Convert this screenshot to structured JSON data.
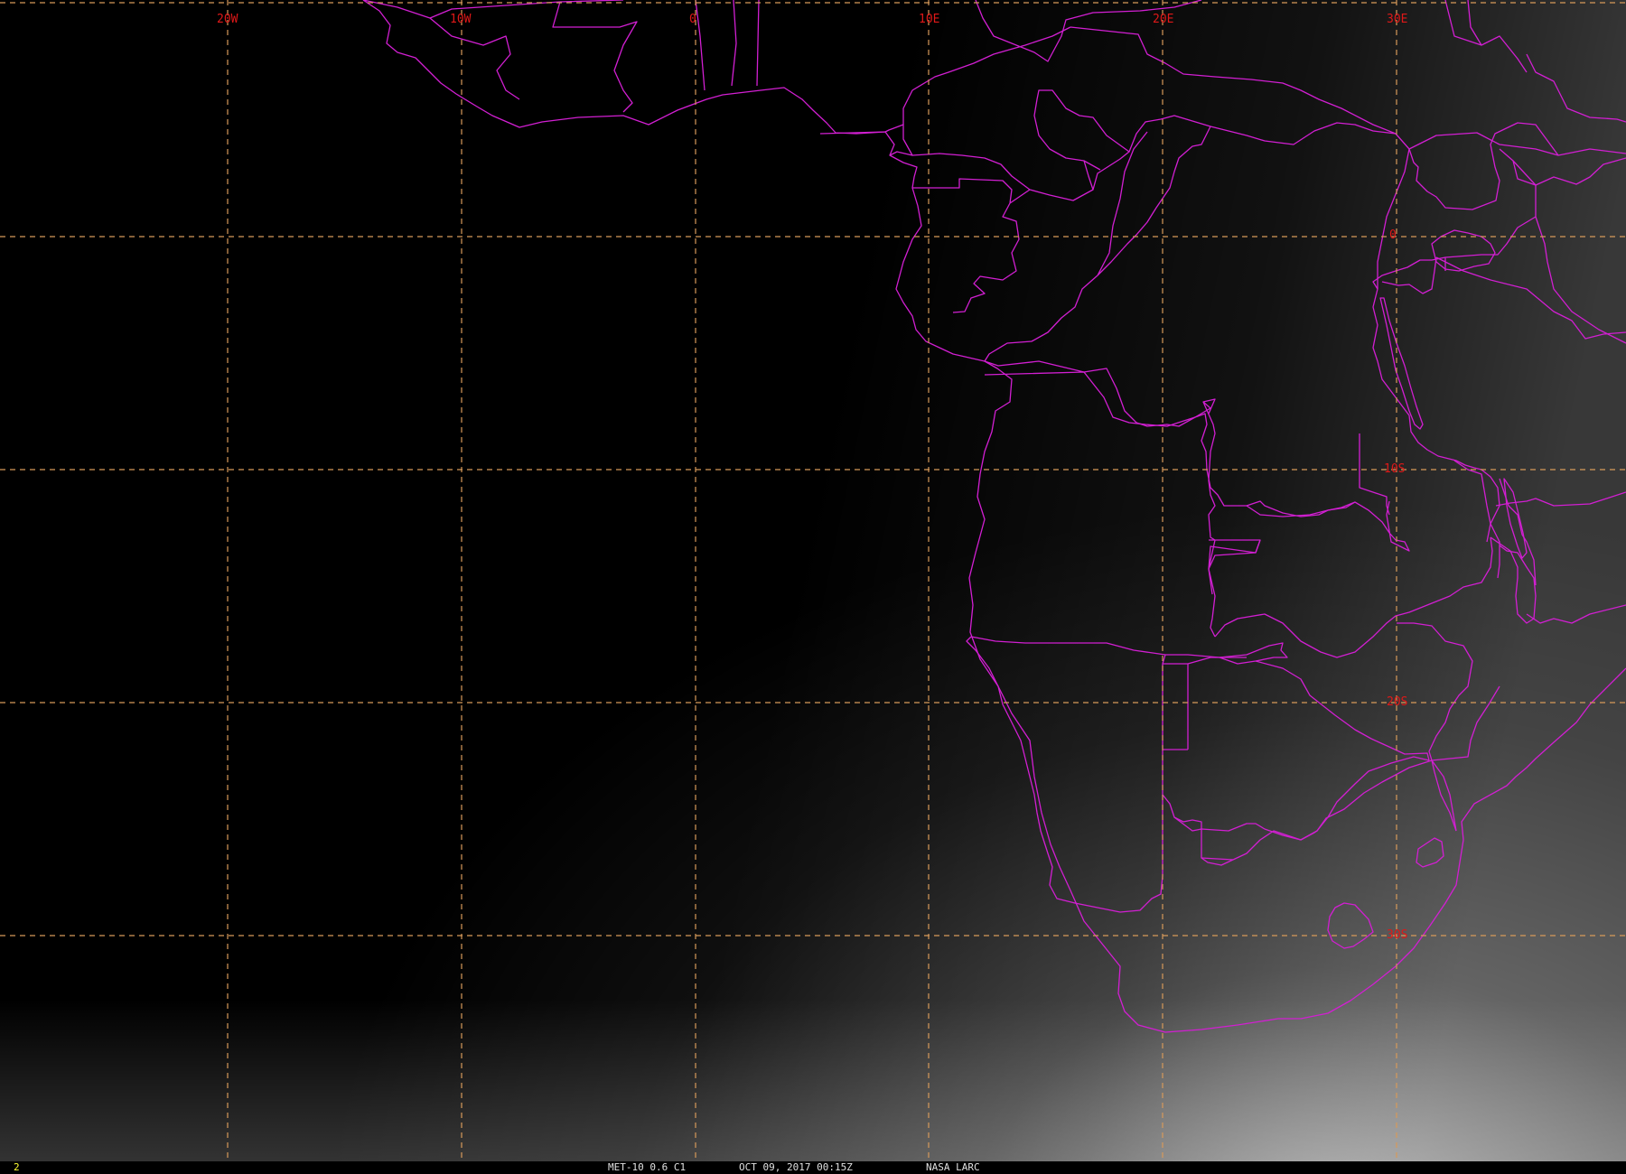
{
  "frame": {
    "number": "2"
  },
  "status": {
    "product": "MET-10 0.6 C1",
    "datetime": "OCT 09, 2017 00:15Z",
    "source": "NASA LARC"
  },
  "colors": {
    "background": "#000000",
    "coastline": "#d21fd2",
    "grid_line": "#d79a5a",
    "grid_label": "#e01818",
    "frame_number": "#ffff33",
    "status_text": "#e0e0e0"
  },
  "map": {
    "longitude_labels": [
      "20W",
      "10W",
      "0",
      "10E",
      "20E",
      "30E"
    ],
    "latitude_labels": [
      "0",
      "10S",
      "20S",
      "30S"
    ]
  }
}
